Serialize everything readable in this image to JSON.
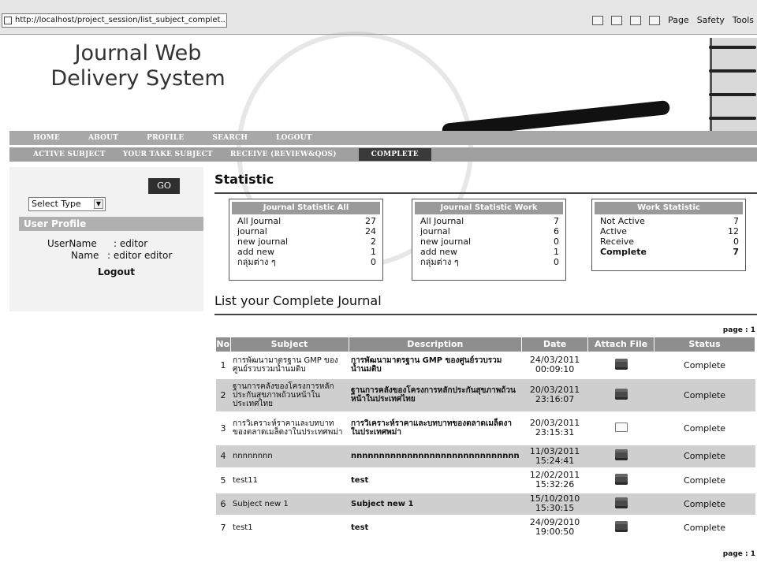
{
  "browser": {
    "url": "http://localhost/project_session/list_subject_complet...",
    "tools": [
      "Page",
      "Safety",
      "Tools"
    ]
  },
  "header": {
    "title_line1": "Journal Web",
    "title_line2": "Delivery System"
  },
  "nav_main": [
    "HOME",
    "ABOUT",
    "PROFILE",
    "SEARCH",
    "LOGOUT"
  ],
  "nav_sub": [
    "ACTIVE SUBJECT",
    "YOUR TAKE SUBJECT",
    "RECEIVE (REVIEW&QOS)",
    "COMPLETE"
  ],
  "sidebar": {
    "go_label": "GO",
    "select_value": "Select Type",
    "user_profile_title": "User Profile",
    "username_label": "UserName",
    "username_value": ": editor",
    "name_label": "Name",
    "name_value": ": editor editor",
    "logout_label": "Logout"
  },
  "statistic": {
    "title": "Statistic",
    "all": {
      "heading": "Journal Statistic All",
      "rows": [
        {
          "label": "All Journal",
          "value": "27"
        },
        {
          "label": "journal",
          "value": "24"
        },
        {
          "label": "new journal",
          "value": "2"
        },
        {
          "label": "add new",
          "value": "1"
        },
        {
          "label": "กลุ่มต่าง ๆ",
          "value": "0"
        }
      ]
    },
    "work": {
      "heading": "Journal Statistic Work",
      "rows": [
        {
          "label": "All Journal",
          "value": "7"
        },
        {
          "label": "journal",
          "value": "6"
        },
        {
          "label": "new journal",
          "value": "0"
        },
        {
          "label": "add new",
          "value": "1"
        },
        {
          "label": "กลุ่มต่าง ๆ",
          "value": "0"
        }
      ]
    },
    "work_status": {
      "heading": "Work Statistic",
      "rows": [
        {
          "label": "Not Active",
          "value": "7"
        },
        {
          "label": "Active",
          "value": "12"
        },
        {
          "label": "Receive",
          "value": "0"
        },
        {
          "label": "Complete",
          "value": "7"
        }
      ]
    }
  },
  "list": {
    "title": "List your Complete Journal",
    "page_label": "page : 1",
    "columns": [
      "No",
      "Subject",
      "Description",
      "Date",
      "Attach File",
      "Status"
    ],
    "rows": [
      {
        "no": "1",
        "subject": "การพัฒนามาตรฐาน GMP ของศูนย์รวบรวมน้ำนมดิบ",
        "description": "การพัฒนามาตรฐาน GMP ของศูนย์รวบรวมน้ำนมดิบ",
        "date": "24/03/2011 00:09:10",
        "attach": "file",
        "status": "Complete"
      },
      {
        "no": "2",
        "subject": "ฐานการคลังของโครงการหลักประกันสุขภาพถ้วนหน้าในประเทศไทย",
        "description": "ฐานการคลังของโครงการหลักประกันสุขภาพถ้วนหน้าในประเทศไทย",
        "date": "20/03/2011 23:16:07",
        "attach": "file",
        "status": "Complete"
      },
      {
        "no": "3",
        "subject": "การวิเคราะห์ราคาและบทบาทของตลาดเมล็ดงาในประเทศพม่า",
        "description": "การวิเคราะห์ราคาและบทบาทของตลาดเมล็ดงาในประเทศพม่า",
        "date": "20/03/2011 23:15:31",
        "attach": "empty",
        "status": "Complete"
      },
      {
        "no": "4",
        "subject": "nnnnnnnn",
        "description": "nnnnnnnnnnnnnnnnnnnnnnnnnnnnnn",
        "date": "11/03/2011 15:24:41",
        "attach": "file",
        "status": "Complete"
      },
      {
        "no": "5",
        "subject": "test11",
        "description": "test",
        "date": "12/02/2011 15:32:26",
        "attach": "file",
        "status": "Complete"
      },
      {
        "no": "6",
        "subject": "Subject new 1",
        "description": "Subject new 1",
        "date": "15/10/2010 15:30:15",
        "attach": "file",
        "status": "Complete"
      },
      {
        "no": "7",
        "subject": "test1",
        "description": "test",
        "date": "24/09/2010 19:00:50",
        "attach": "file",
        "status": "Complete"
      }
    ]
  }
}
